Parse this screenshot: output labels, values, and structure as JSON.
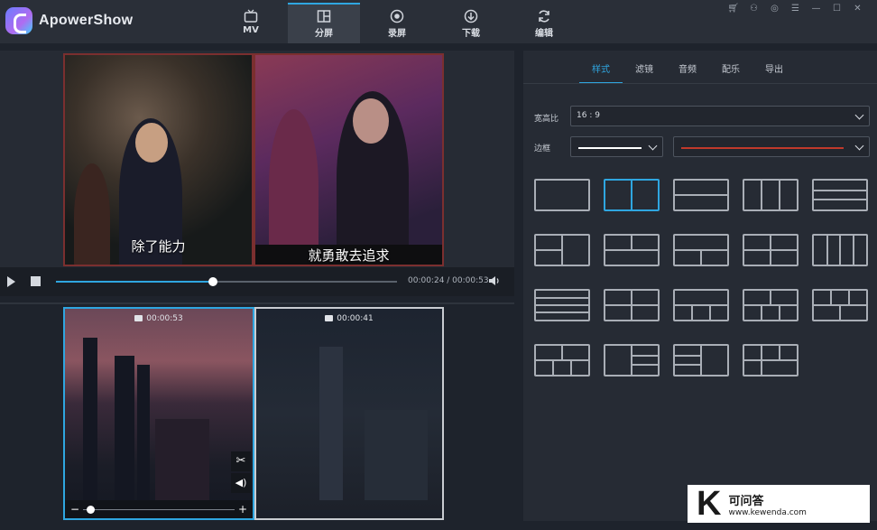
{
  "app": {
    "name": "ApowerShow"
  },
  "nav": [
    {
      "label": "MV",
      "icon": "tv-icon"
    },
    {
      "label": "分屏",
      "icon": "split-screen-icon",
      "active": true
    },
    {
      "label": "录屏",
      "icon": "record-icon"
    },
    {
      "label": "下载",
      "icon": "download-icon"
    },
    {
      "label": "编辑",
      "icon": "refresh-edit-icon"
    }
  ],
  "window_controls": [
    "cart-icon",
    "user-icon",
    "support-icon",
    "menu-icon",
    "minimize-icon",
    "maximize-icon",
    "close-icon"
  ],
  "preview": {
    "captions": [
      "除了能力",
      "就勇敢去追求"
    ],
    "player": {
      "time": "00:00:24 / 00:00:53",
      "progress": 0.46
    }
  },
  "clips": [
    {
      "duration": "00:00:53",
      "slider_level": 0.05
    },
    {
      "duration": "00:00:41"
    }
  ],
  "clip_tools": [
    "scissors-icon",
    "volume-icon"
  ],
  "panel": {
    "tabs": [
      "样式",
      "滤镜",
      "音频",
      "配乐",
      "导出"
    ],
    "active_tab": 0,
    "aspect_label": "宽高比",
    "aspect_value": "16 : 9",
    "border_label": "边框",
    "border_color": "#c0392b",
    "border_line_color": "#ffffff"
  },
  "templates_selected": 1,
  "watermark": {
    "letter": "K",
    "title": "可问答",
    "url": "www.kewenda.com"
  },
  "colors": {
    "accent": "#2fa6e0",
    "background": "#1e232c",
    "panel": "#262b34"
  }
}
